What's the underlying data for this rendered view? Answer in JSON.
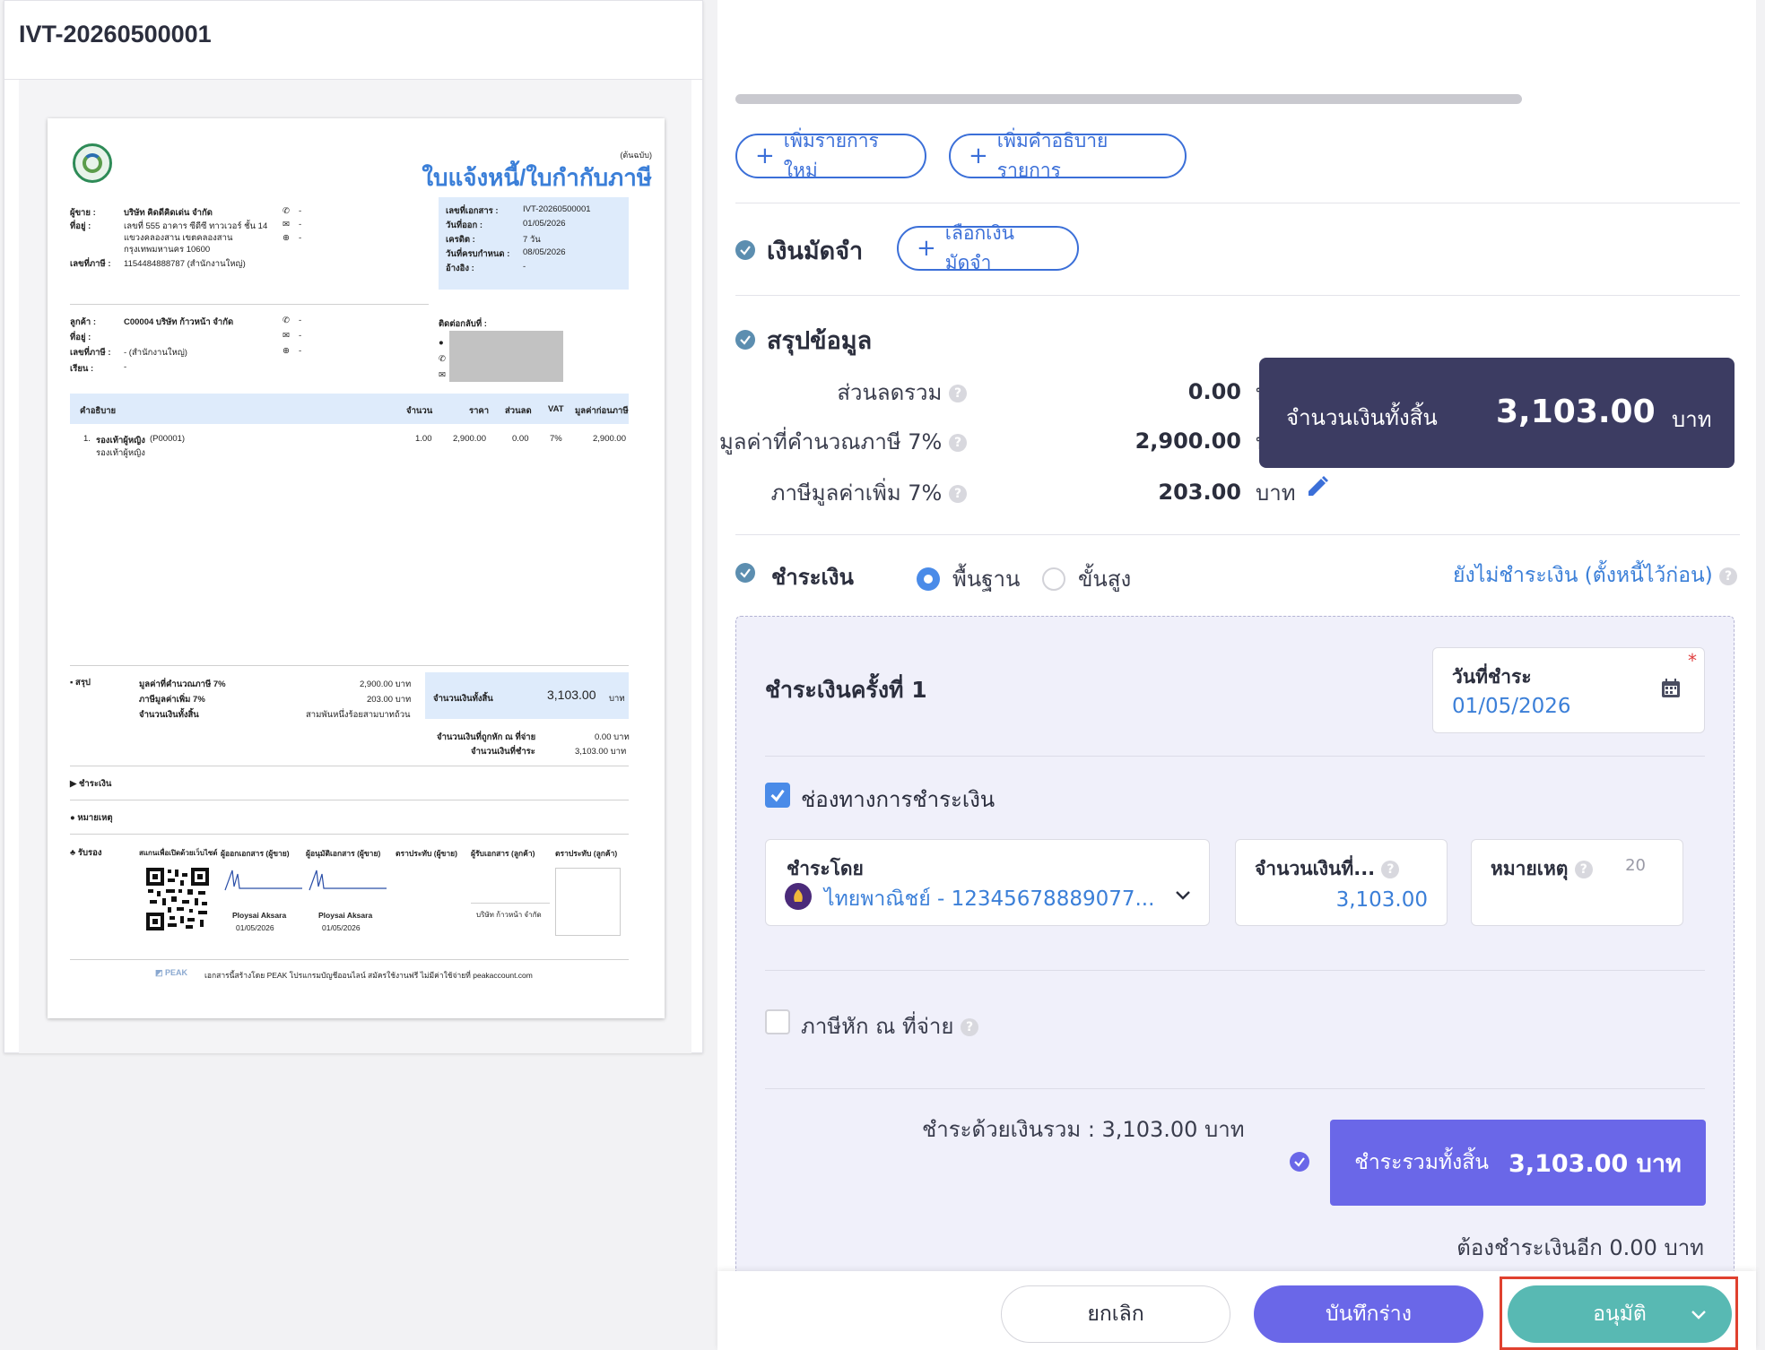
{
  "preview": {
    "doc_id": "IVT-20260500001",
    "copy_label": "(ต้นฉบับ)",
    "doc_title": "ใบแจ้งหนี้/ใบกำกับภาษี",
    "seller": {
      "seller_label": "ผู้ขาย :",
      "seller_name": "บริษัท คิดดีคิดเด่น จำกัด",
      "address_label": "ที่อยู่ :",
      "address_1": "เลขที่ 555 อาคาร ซีดีซี ทาวเวอร์ ชั้น 14",
      "address_2": "แขวงคลองสาน เขตคลองสาน",
      "address_3": "กรุงเทพมหานคร 10600",
      "tax_label": "เลขที่ภาษี :",
      "tax_id": "1154484888787 (สำนักงานใหญ่)",
      "phone": "-",
      "email": "-",
      "web": "-"
    },
    "docinfo": {
      "no_label": "เลขที่เอกสาร :",
      "no": "IVT-20260500001",
      "date_label": "วันที่ออก :",
      "date": "01/05/2026",
      "credit_label": "เครดิต :",
      "credit": "7 วัน",
      "due_label": "วันที่ครบกำหนด :",
      "due": "08/05/2026",
      "ref_label": "อ้างอิง :",
      "ref": "-"
    },
    "customer": {
      "cust_label": "ลูกค้า :",
      "cust_name": "C00004 บริษัท ก้าวหน้า จำกัด",
      "address_label": "ที่อยู่ :",
      "tax_label": "เลขที่ภาษี :",
      "tax_id": "- (สำนักงานใหญ่)",
      "attn_label": "เรียน :",
      "attn": "-",
      "phone": "-",
      "email": "-",
      "web": "-",
      "contact_label": "ติดต่อกลับที่ :"
    },
    "table": {
      "headers": [
        "คำอธิบาย",
        "จำนวน",
        "ราคา",
        "ส่วนลด",
        "VAT",
        "มูลค่าก่อนภาษี"
      ],
      "row_no": "1.",
      "row_name": "รองเท้าผู้หญิง",
      "row_code": "(P00001)",
      "row_desc": "รองเท้าผู้หญิง",
      "row_vals": [
        "1.00",
        "2,900.00",
        "0.00",
        "7%",
        "2,900.00"
      ]
    },
    "summary": {
      "label": "สรุป",
      "taxable_label": "มูลค่าที่คำนวณภาษี 7%",
      "taxable": "2,900.00 บาท",
      "vat_label": "ภาษีมูลค่าเพิ่ม 7%",
      "vat": "203.00 บาท",
      "total_label": "จำนวนเงินทั้งสิ้น",
      "total_words": "สามพันหนึ่งร้อยสามบาทถ้วน",
      "box_label": "จำนวนเงินทั้งสิ้น",
      "box_value": "3,103.00",
      "box_unit": "บาท",
      "wht_label": "จำนวนเงินที่ถูกหัก ณ ที่จ่าย",
      "wht": "0.00 บาท",
      "topay_label": "จำนวนเงินที่ชำระ",
      "topay": "3,103.00 บาท"
    },
    "payment_label": "ชำระเงิน",
    "note_label": "หมายเหตุ",
    "sign": {
      "label": "รับรอง",
      "qr_caption": "สแกนเพื่อเปิดด้วยเว็บไซต์",
      "issuer": "ผู้ออกเอกสาร (ผู้ขาย)",
      "approver": "ผู้อนุมัติเอกสาร (ผู้ขาย)",
      "seller_stamp": "ตราประทับ (ผู้ขาย)",
      "receiver": "ผู้รับเอกสาร (ลูกค้า)",
      "cust_stamp": "ตราประทับ (ลูกค้า)",
      "name1": "Ploysai Aksara",
      "date1": "01/05/2026",
      "name2": "Ploysai Aksara",
      "date2": "01/05/2026",
      "cust_company": "บริษัท ก้าวหน้า จำกัด"
    },
    "footer": "เอกสารนี้สร้างโดย PEAK โปรแกรมบัญชีออนไลน์ สมัครใช้งานฟรี ไม่มีค่าใช้จ่ายที่ peakaccount.com",
    "footer_logo": "PEAK"
  },
  "form": {
    "add_item": "เพิ่มรายการใหม่",
    "add_desc": "เพิ่มคำอธิบายรายการ",
    "deposit": {
      "title": "เงินมัดจำ",
      "select": "เลือกเงินมัดจำ"
    },
    "summary": {
      "title": "สรุปข้อมูล",
      "discount_label": "ส่วนลดรวม",
      "discount": "0.00",
      "taxable_label": "มูลค่าที่คำนวณภาษี 7%",
      "taxable": "2,900.00",
      "vat_label": "ภาษีมูลค่าเพิ่ม 7%",
      "vat": "203.00",
      "unit": "บาท",
      "total_label": "จำนวนเงินทั้งสิ้น",
      "total": "3,103.00",
      "total_unit": "บาท"
    },
    "payment": {
      "title": "ชำระเงิน",
      "mode_basic": "พื้นฐาน",
      "mode_advanced": "ขั้นสูง",
      "unpaid_link": "ยังไม่ชำระเงิน (ตั้งหนี้ไว้ก่อน)",
      "installment_title": "ชำระเงินครั้งที่ 1",
      "date_label": "วันที่ชำระ",
      "date": "01/05/2026",
      "channel_label": "ช่องทางการชำระเงิน",
      "payby_label": "ชำระโดย",
      "payby": "ไทยพาณิชย์ - 12345678889077...",
      "amount_label": "จำนวนเงินที่...",
      "amount": "3,103.00",
      "note_label": "หมายเหตุ",
      "note_count": "20",
      "wht_label": "ภาษีหัก ณ ที่จ่าย",
      "paid_total_text": "ชำระด้วยเงินรวม : 3,103.00 บาท",
      "pay_all_label": "ชำระรวมทั้งสิ้น",
      "pay_all_value": "3,103.00 บาท",
      "remaining": "ต้องชำระเงินอีก 0.00 บาท"
    },
    "actions": {
      "cancel": "ยกเลิก",
      "draft": "บันทึกร่าง",
      "approve": "อนุมัติ"
    }
  },
  "colors": {
    "primary_blue": "#3b6fd8",
    "navy_total": "#3c3c62",
    "purple": "#6a67e8",
    "teal": "#58b9b3",
    "check": "#5c8eb0",
    "highlight_red": "#e0412f"
  }
}
